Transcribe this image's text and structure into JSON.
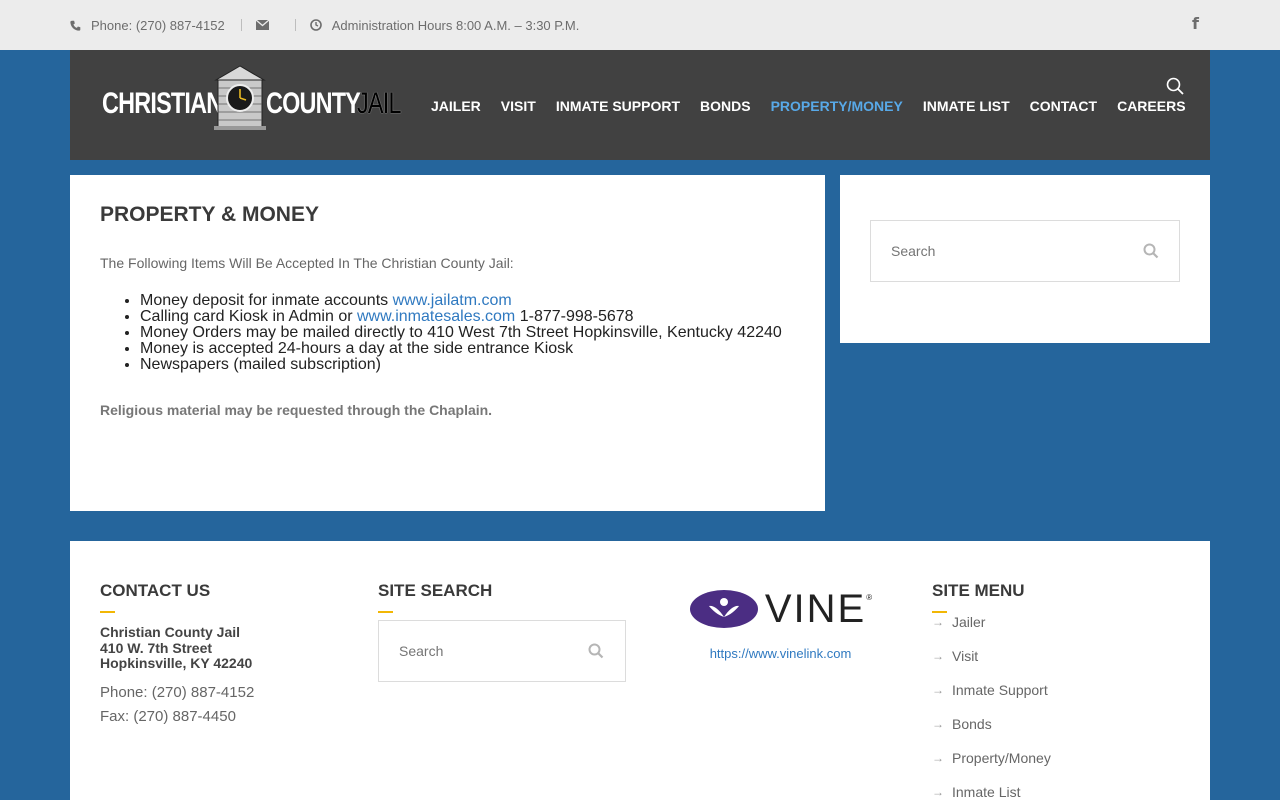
{
  "topbar": {
    "phone": "Phone: (270) 887-4152",
    "hours": "Administration Hours 8:00 A.M. – 3:30 P.M.",
    "icons": [
      "phone-icon",
      "envelope-icon",
      "clock-icon",
      "facebook-icon"
    ]
  },
  "header": {
    "logo": {
      "word1": "CHRISTIAN",
      "word2": "COUNTY",
      "word3": "JAIL"
    },
    "nav": [
      "JAILER",
      "VISIT",
      "INMATE SUPPORT",
      "BONDS",
      "PROPERTY/MONEY",
      "INMATE LIST",
      "CONTACT",
      "CAREERS"
    ],
    "active_nav": "PROPERTY/MONEY"
  },
  "main": {
    "title": "PROPERTY & MONEY",
    "intro": "The Following Items Will Be Accepted In The Christian County Jail:",
    "items": [
      {
        "text": "Money deposit for inmate accounts ",
        "link": "www.jailatm.com",
        "after": ""
      },
      {
        "text": "Calling card Kiosk in Admin or ",
        "link": "www.inmatesales.com",
        "after": " 1-877-998-5678"
      },
      {
        "text": "Money Orders may be mailed directly to 410 West 7th Street Hopkinsville, Kentucky 42240",
        "link": "",
        "after": ""
      },
      {
        "text": "Money is accepted 24-hours a day at the side entrance Kiosk",
        "link": "",
        "after": ""
      },
      {
        "text": "Newspapers (mailed subscription)",
        "link": "",
        "after": ""
      }
    ],
    "note": "Religious material may be requested through the Chaplain."
  },
  "sidebar": {
    "search_placeholder": "Search"
  },
  "footer": {
    "contact": {
      "heading": "CONTACT US",
      "name": "Christian County Jail",
      "street": "410 W. 7th Street",
      "city": "Hopkinsville, KY 42240",
      "phone": "Phone: (270) 887-4152",
      "fax": "Fax: (270) 887-4450"
    },
    "site_search": {
      "heading": "SITE SEARCH",
      "placeholder": "Search"
    },
    "vine": {
      "logo_text": "VINE",
      "url": "https://www.vinelink.com"
    },
    "site_menu": {
      "heading": "SITE MENU",
      "items": [
        "Jailer",
        "Visit",
        "Inmate Support",
        "Bonds",
        "Property/Money",
        "Inmate List"
      ]
    }
  },
  "colors": {
    "page_bg": "#25659c",
    "header_bg": "#414141",
    "accent_link": "#2f79c0",
    "active_nav": "#58a9e8",
    "divider": "#f2b705"
  }
}
